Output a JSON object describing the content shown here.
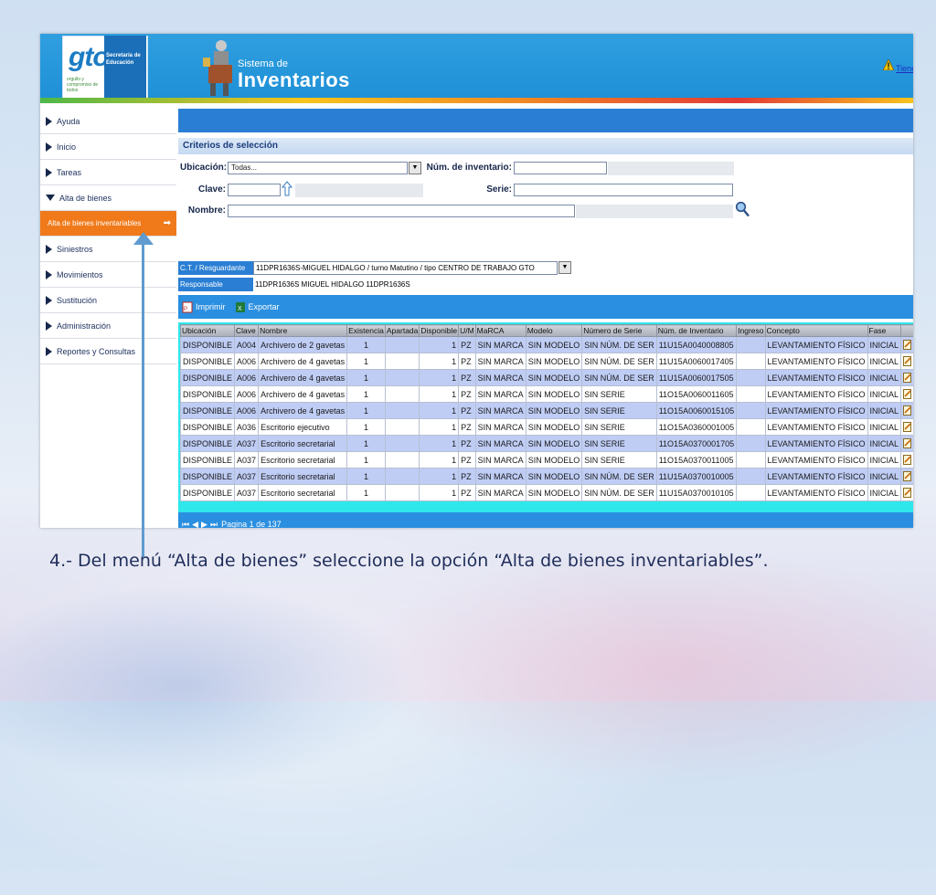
{
  "header": {
    "logo": "gto",
    "logo_sub": "orgullo y compromiso de todos",
    "secretaria": "Secretaría de Educación",
    "system_small": "Sistema de",
    "system_big": "Inventarios",
    "tiene_link": "Tiene"
  },
  "sidebar": {
    "items": [
      {
        "label": "Ayuda",
        "expanded": false
      },
      {
        "label": "Inicio",
        "expanded": false
      },
      {
        "label": "Tareas",
        "expanded": false
      },
      {
        "label": "Alta de bienes",
        "expanded": true
      },
      {
        "label": "Alta de bienes inventariables",
        "active": true,
        "arrow": "➡"
      },
      {
        "label": "Siniestros",
        "expanded": false
      },
      {
        "label": "Movimientos",
        "expanded": false
      },
      {
        "label": "Sustitución",
        "expanded": false
      },
      {
        "label": "Administración",
        "expanded": false
      },
      {
        "label": "Reportes y Consultas",
        "expanded": false
      }
    ]
  },
  "criteria": {
    "title": "Criterios de selección",
    "ubicacion_label": "Ubicación:",
    "ubicacion_value": "Todas...",
    "num_inv_label": "Núm. de inventario:",
    "num_inv_value": "",
    "clave_label": "Clave:",
    "clave_value": "",
    "serie_label": "Serie:",
    "serie_value": "",
    "nombre_label": "Nombre:",
    "nombre_value": "",
    "ct_label": "C.T. / Resguardante",
    "ct_value": "11DPR1636S-MIGUEL HIDALGO / turno Matutino / tipo CENTRO DE TRABAJO GTO",
    "resp_label": "Responsable",
    "resp_value": "11DPR1636S  MIGUEL HIDALGO 11DPR1636S"
  },
  "toolbar": {
    "imprimir": "Imprimir",
    "exportar": "Exportar"
  },
  "pager": {
    "text": "Pagina  1 de 137"
  },
  "table": {
    "columns": [
      "Ubicación",
      "Clave",
      "Nombre",
      "Existencia",
      "Apartada",
      "Disponible",
      "U/M",
      "MaRCA",
      "Modelo",
      "Número de Serie",
      "Núm. de Inventario",
      "Ingreso",
      "Concepto",
      "Fase",
      ""
    ],
    "rows": [
      [
        "DISPONIBLE",
        "A004",
        "Archivero de 2 gavetas",
        "1",
        "",
        "1",
        "PZ",
        "SIN MARCA",
        "SIN MODELO",
        "SIN NÚM. DE SER",
        "11U15A0040008805",
        "",
        "LEVANTAMIENTO FÍSICO",
        "INICIAL"
      ],
      [
        "DISPONIBLE",
        "A006",
        "Archivero de 4 gavetas",
        "1",
        "",
        "1",
        "PZ",
        "SIN MARCA",
        "SIN MODELO",
        "SIN NÚM. DE SER",
        "11U15A0060017405",
        "",
        "LEVANTAMIENTO FÍSICO",
        "INICIAL"
      ],
      [
        "DISPONIBLE",
        "A006",
        "Archivero de 4 gavetas",
        "1",
        "",
        "1",
        "PZ",
        "SIN MARCA",
        "SIN MODELO",
        "SIN NÚM. DE SER",
        "11U15A0060017505",
        "",
        "LEVANTAMIENTO FÍSICO",
        "INICIAL"
      ],
      [
        "DISPONIBLE",
        "A006",
        "Archivero de 4 gavetas",
        "1",
        "",
        "1",
        "PZ",
        "SIN MARCA",
        "SIN MODELO",
        "SIN SERIE",
        "11O15A0060011605",
        "",
        "LEVANTAMIENTO FÍSICO",
        "INICIAL"
      ],
      [
        "DISPONIBLE",
        "A006",
        "Archivero de 4 gavetas",
        "1",
        "",
        "1",
        "PZ",
        "SIN MARCA",
        "SIN MODELO",
        "SIN SERIE",
        "11O15A0060015105",
        "",
        "LEVANTAMIENTO FÍSICO",
        "INICIAL"
      ],
      [
        "DISPONIBLE",
        "A036",
        "Escritorio ejecutivo",
        "1",
        "",
        "1",
        "PZ",
        "SIN MARCA",
        "SIN MODELO",
        "SIN SERIE",
        "11O15A0360001005",
        "",
        "LEVANTAMIENTO FÍSICO",
        "INICIAL"
      ],
      [
        "DISPONIBLE",
        "A037",
        "Escritorio secretarial",
        "1",
        "",
        "1",
        "PZ",
        "SIN MARCA",
        "SIN MODELO",
        "SIN SERIE",
        "11O15A0370001705",
        "",
        "LEVANTAMIENTO FÍSICO",
        "INICIAL"
      ],
      [
        "DISPONIBLE",
        "A037",
        "Escritorio secretarial",
        "1",
        "",
        "1",
        "PZ",
        "SIN MARCA",
        "SIN MODELO",
        "SIN SERIE",
        "11O15A0370011005",
        "",
        "LEVANTAMIENTO FÍSICO",
        "INICIAL"
      ],
      [
        "DISPONIBLE",
        "A037",
        "Escritorio secretarial",
        "1",
        "",
        "1",
        "PZ",
        "SIN MARCA",
        "SIN MODELO",
        "SIN NÚM. DE SER",
        "11U15A0370010005",
        "",
        "LEVANTAMIENTO FÍSICO",
        "INICIAL"
      ],
      [
        "DISPONIBLE",
        "A037",
        "Escritorio secretarial",
        "1",
        "",
        "1",
        "PZ",
        "SIN MARCA",
        "SIN MODELO",
        "SIN NÚM. DE SER",
        "11U15A0370010105",
        "",
        "LEVANTAMIENTO FÍSICO",
        "INICIAL"
      ]
    ]
  },
  "caption": "4.- Del menú “Alta de bienes” seleccione la opción “Alta de bienes inventariables”.",
  "colors": {
    "header_blue": "#1e8fd6",
    "bar_blue": "#2a8fe0",
    "active_orange": "#f07a1a",
    "grid_cyan": "#2ee8ec",
    "row_alt": "#bfcdf5"
  }
}
